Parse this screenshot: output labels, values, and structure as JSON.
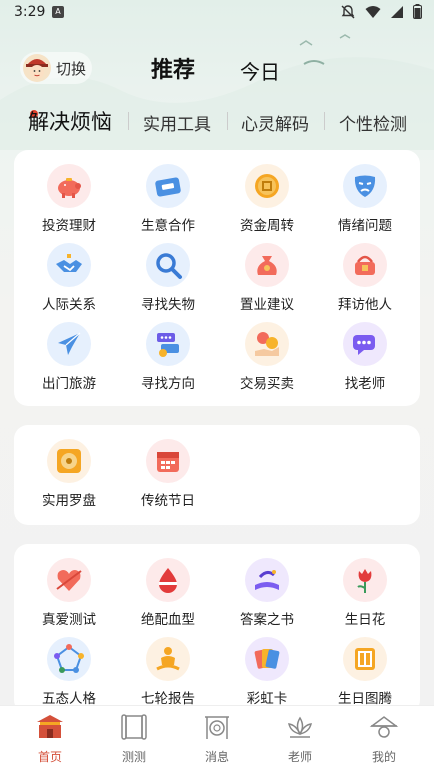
{
  "status_bar": {
    "time": "3:29",
    "a_icon": "A"
  },
  "header": {
    "switch_label": "切换",
    "tabs": [
      {
        "label": "推荐",
        "active": true
      },
      {
        "label": "今日",
        "active": false
      }
    ]
  },
  "category_tabs": [
    {
      "label": "解决烦恼",
      "active": true
    },
    {
      "label": "实用工具",
      "active": false
    },
    {
      "label": "心灵解码",
      "active": false
    },
    {
      "label": "个性检测",
      "active": false
    }
  ],
  "section1": {
    "items": [
      {
        "label": "投资理财",
        "icon": "piggy-bank-icon",
        "bg": "#fdeaea"
      },
      {
        "label": "生意合作",
        "icon": "ticket-icon",
        "bg": "#e6f0fd"
      },
      {
        "label": "资金周转",
        "icon": "coin-icon",
        "bg": "#fdf1e2"
      },
      {
        "label": "情绪问题",
        "icon": "mask-icon",
        "bg": "#e6f0fd"
      },
      {
        "label": "人际关系",
        "icon": "handshake-icon",
        "bg": "#e6f0fd"
      },
      {
        "label": "寻找失物",
        "icon": "magnifier-icon",
        "bg": "#e6f0fd"
      },
      {
        "label": "置业建议",
        "icon": "money-bag-icon",
        "bg": "#fdeaea"
      },
      {
        "label": "拜访他人",
        "icon": "gift-basket-icon",
        "bg": "#fdeaea"
      },
      {
        "label": "出门旅游",
        "icon": "airplane-icon",
        "bg": "#e6f0fd"
      },
      {
        "label": "寻找方向",
        "icon": "signpost-icon",
        "bg": "#e6f0fd"
      },
      {
        "label": "交易买卖",
        "icon": "trade-hand-icon",
        "bg": "#fdf1e2"
      },
      {
        "label": "找老师",
        "icon": "chat-bubble-icon",
        "bg": "#efe8fd"
      }
    ]
  },
  "section2": {
    "items": [
      {
        "label": "实用罗盘",
        "icon": "compass-icon",
        "bg": "#fdf1e2"
      },
      {
        "label": "传统节日",
        "icon": "calendar-icon",
        "bg": "#fdeaea"
      }
    ]
  },
  "section3": {
    "items": [
      {
        "label": "真爱测试",
        "icon": "heart-arrow-icon",
        "bg": "#fdeaea"
      },
      {
        "label": "绝配血型",
        "icon": "blood-drop-icon",
        "bg": "#fdeaea"
      },
      {
        "label": "答案之书",
        "icon": "book-icon",
        "bg": "#efe8fd"
      },
      {
        "label": "生日花",
        "icon": "rose-icon",
        "bg": "#fdeaea"
      },
      {
        "label": "五态人格",
        "icon": "network-icon",
        "bg": "#e6f0fd"
      },
      {
        "label": "七轮报告",
        "icon": "meditation-icon",
        "bg": "#fdf1e2"
      },
      {
        "label": "彩虹卡",
        "icon": "rainbow-cards-icon",
        "bg": "#efe8fd"
      },
      {
        "label": "生日图腾",
        "icon": "totem-icon",
        "bg": "#fdf1e2"
      }
    ]
  },
  "bottom_nav": [
    {
      "label": "首页",
      "icon": "palace-icon",
      "active": true
    },
    {
      "label": "测测",
      "icon": "scroll-icon",
      "active": false
    },
    {
      "label": "消息",
      "icon": "gong-icon",
      "active": false
    },
    {
      "label": "老师",
      "icon": "lotus-icon",
      "active": false
    },
    {
      "label": "我的",
      "icon": "hat-icon",
      "active": false
    }
  ],
  "colors": {
    "accent": "#d4503a",
    "background": "#f2f2f2",
    "card": "#ffffff"
  }
}
